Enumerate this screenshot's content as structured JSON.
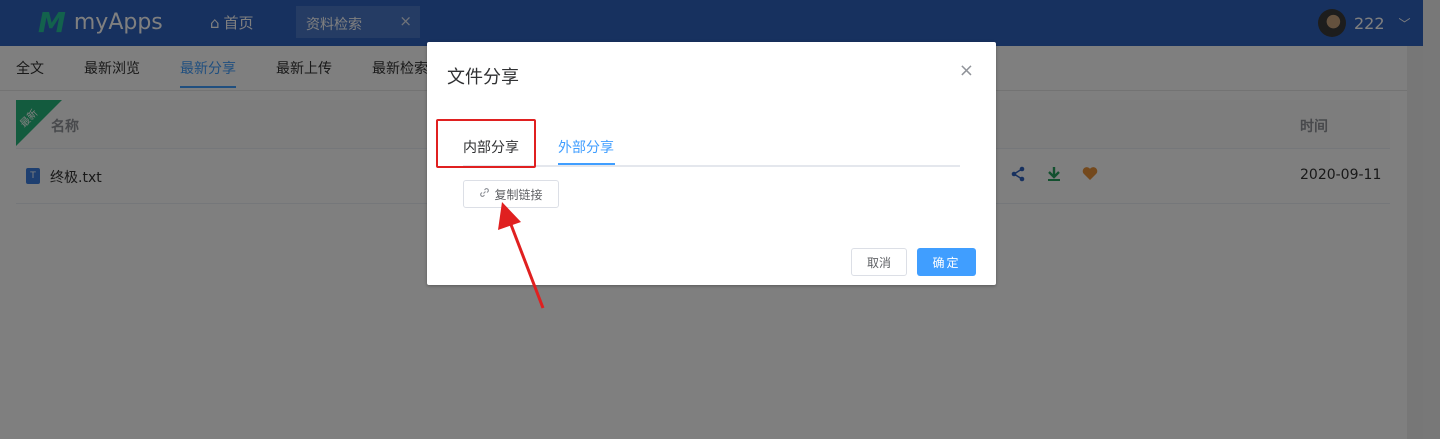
{
  "app": {
    "logo_mark": "M",
    "name": "myApps"
  },
  "nav": {
    "home_label": "首页",
    "tab_label": "资料检索",
    "close_symbol": "×"
  },
  "user": {
    "name": "222"
  },
  "subtabs": [
    {
      "label": "全文"
    },
    {
      "label": "最新浏览"
    },
    {
      "label": "最新分享",
      "active": true
    },
    {
      "label": "最新上传"
    },
    {
      "label": "最新检索"
    }
  ],
  "table": {
    "ribbon": "最新",
    "headers": {
      "name": "名称",
      "time": "时间"
    },
    "rows": [
      {
        "file_icon_text": "T",
        "name": "终极.txt",
        "time": "2020-09-11"
      }
    ]
  },
  "dialog": {
    "title": "文件分享",
    "close_symbol": "×",
    "tabs": [
      {
        "label": "内部分享"
      },
      {
        "label": "外部分享",
        "active": true
      }
    ],
    "copy_link_label": "复制链接",
    "cancel_label": "取消",
    "ok_label": "确定"
  },
  "colors": {
    "topbar": "#2f62bf",
    "accent": "#409eff",
    "brand_green": "#27c49a",
    "annotation": "#e02020"
  }
}
